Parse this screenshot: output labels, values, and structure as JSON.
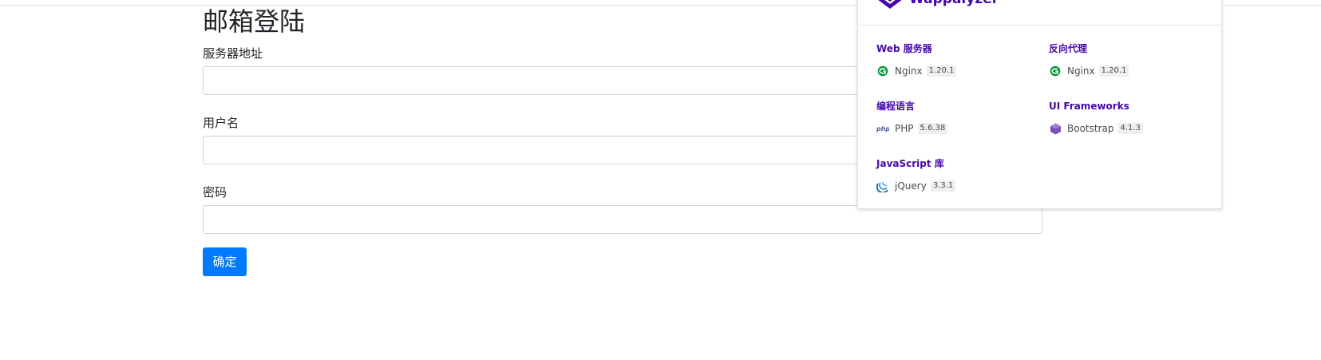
{
  "login": {
    "title": "邮箱登陆",
    "fields": [
      {
        "label": "服务器地址",
        "value": "",
        "placeholder": ""
      },
      {
        "label": "用户名",
        "value": "",
        "placeholder": ""
      },
      {
        "label": "密码",
        "value": "",
        "placeholder": ""
      }
    ],
    "submit_label": "确定",
    "colors": {
      "primary": "#007bff"
    }
  },
  "wappalyzer": {
    "brand": "Wappalyzer",
    "accent": "#4608ad",
    "categories": [
      {
        "name": "Web 服务器",
        "techs": [
          {
            "name": "Nginx",
            "version": "1.20.1",
            "icon": "nginx-icon"
          }
        ]
      },
      {
        "name": "反向代理",
        "techs": [
          {
            "name": "Nginx",
            "version": "1.20.1",
            "icon": "nginx-icon"
          }
        ]
      },
      {
        "name": "编程语言",
        "techs": [
          {
            "name": "PHP",
            "version": "5.6.38",
            "icon": "php-icon"
          }
        ]
      },
      {
        "name": "UI Frameworks",
        "techs": [
          {
            "name": "Bootstrap",
            "version": "4.1.3",
            "icon": "bootstrap-icon"
          }
        ]
      },
      {
        "name": "JavaScript 库",
        "techs": [
          {
            "name": "jQuery",
            "version": "3.3.1",
            "icon": "jquery-icon"
          }
        ]
      }
    ]
  }
}
